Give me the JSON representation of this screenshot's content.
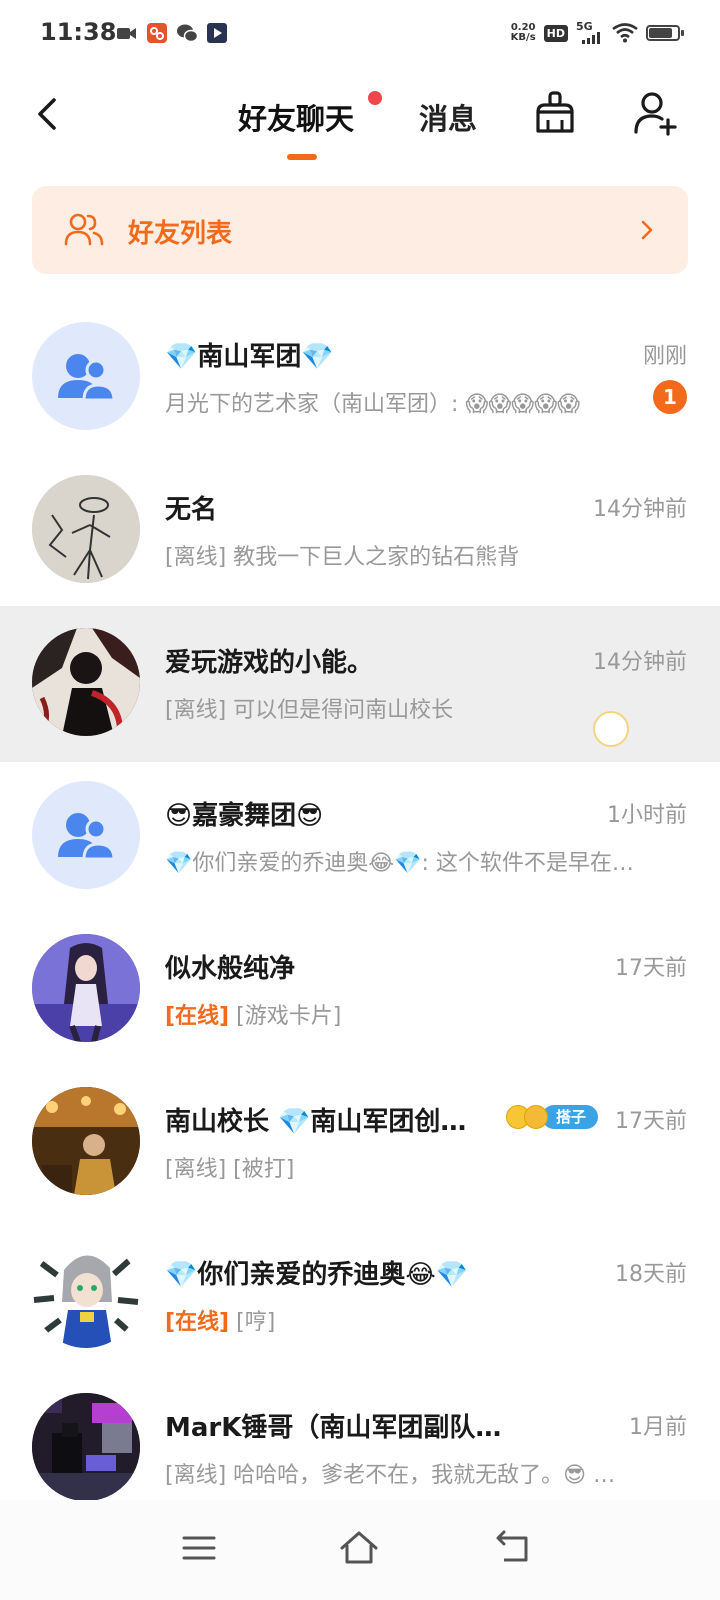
{
  "status_bar": {
    "time": "11:38",
    "net_speed_value": "0.20",
    "net_speed_unit": "KB/s",
    "hd": "HD",
    "network": "5G",
    "battery_level": 0.75,
    "icons": [
      "video-icon",
      "app-icon",
      "wechat-icon",
      "media-icon",
      "signal-icon",
      "wifi-icon",
      "battery-icon"
    ]
  },
  "header": {
    "tabs": [
      {
        "label": "好友聊天",
        "active": true,
        "has_dot": true
      },
      {
        "label": "消息",
        "active": false
      }
    ],
    "accent": "#f26b1d"
  },
  "friend_list_banner": {
    "label": "好友列表"
  },
  "chats": [
    {
      "name": "💎南山军团💎",
      "time": "刚刚",
      "preview": "月光下的艺术家（南山军团）: 😱😱😱😱😱",
      "unread": "1",
      "avatar": "group"
    },
    {
      "name": "无名",
      "time": "14分钟前",
      "status": "[离线]",
      "preview": "教我一下巨人之家的钻石熊背",
      "avatar": "sketch"
    },
    {
      "name": "爱玩游戏的小能。",
      "time": "14分钟前",
      "status": "[离线]",
      "preview": "可以但是得问南山校长",
      "avatar": "dark-art"
    },
    {
      "name": "😎嘉豪舞团😎",
      "time": "1小时前",
      "preview": "💎你们亲爱的乔迪奥😂💎: 这个软件不是早在…",
      "avatar": "group"
    },
    {
      "name": "似水般纯净",
      "time": "17天前",
      "status": "[在线]",
      "preview": "[游戏卡片]",
      "avatar": "anime-purple"
    },
    {
      "name": "南山校长 💎南山军团创…",
      "time": "17天前",
      "status": "[离线]",
      "preview": "[被打]",
      "tag": "搭子",
      "avatar": "golden"
    },
    {
      "name": "💎你们亲爱的乔迪奥😂💎",
      "time": "18天前",
      "status": "[在线]",
      "preview": "[哼]",
      "avatar": "anime-gray"
    },
    {
      "name": "MarK锤哥（南山军团副队长）",
      "time": "1月前",
      "status": "[离线]",
      "preview": "哈哈哈，爹老不在，我就无敌了。😎 …",
      "avatar": "pixel"
    }
  ]
}
